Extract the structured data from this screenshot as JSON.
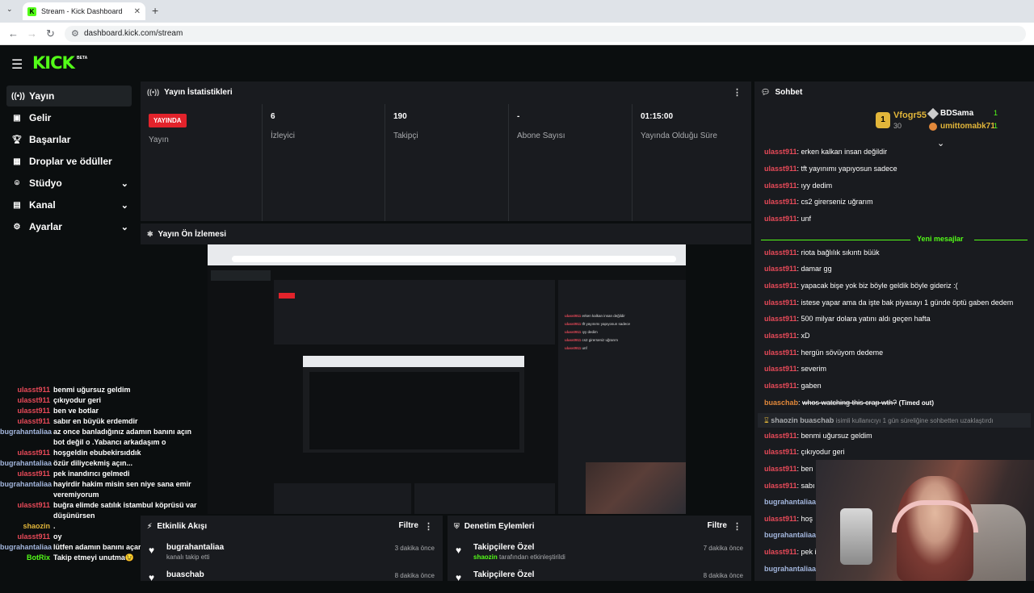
{
  "browser": {
    "tab_title": "Stream - Kick Dashboard",
    "url": "dashboard.kick.com/stream",
    "new_tab": "+",
    "close": "✕"
  },
  "brand": {
    "logo": "KICK",
    "beta": "BETA"
  },
  "sidebar": {
    "items": [
      {
        "label": "Yayın",
        "icon": "broadcast-icon"
      },
      {
        "label": "Gelir",
        "icon": "wallet-icon"
      },
      {
        "label": "Başarılar",
        "icon": "trophy-icon"
      },
      {
        "label": "Droplar ve ödüller",
        "icon": "gift-icon"
      },
      {
        "label": "Stüdyo",
        "icon": "studio-icon"
      },
      {
        "label": "Kanal",
        "icon": "channel-icon"
      },
      {
        "label": "Ayarlar",
        "icon": "gear-icon"
      }
    ]
  },
  "stats": {
    "title": "Yayın İstatistikleri",
    "live_badge": "YAYINDA",
    "live_label": "Yayın",
    "viewers": "6",
    "viewers_label": "İzleyici",
    "followers": "190",
    "followers_label": "Takipçi",
    "subs": "-",
    "subs_label": "Abone Sayısı",
    "uptime": "01:15:00",
    "uptime_label": "Yayında Olduğu Süre"
  },
  "preview": {
    "title": "Yayın Ön İzlemesi"
  },
  "overlay_chat": [
    {
      "user": "ulasst911",
      "msg": "benmi uğursuz geldim",
      "c": ""
    },
    {
      "user": "ulasst911",
      "msg": "çıkıyodur geri",
      "c": ""
    },
    {
      "user": "ulasst911",
      "msg": "ben ve botlar",
      "c": ""
    },
    {
      "user": "ulasst911",
      "msg": "sabır en büyük erdemdir",
      "c": ""
    },
    {
      "user": "bugrahantaliaa",
      "msg": "az once banladığınız adamın banını açın bot değil o .Yabancı arkadaşım o",
      "c": "blue"
    },
    {
      "user": "ulasst911",
      "msg": "hoşgeldin ebubekirsıddık",
      "c": ""
    },
    {
      "user": "bugrahantaliaa",
      "msg": "özür diliycekmiş açın...",
      "c": "blue"
    },
    {
      "user": "ulasst911",
      "msg": "pek inandırıcı gelmedi",
      "c": ""
    },
    {
      "user": "bugrahantaliaa",
      "msg": "hayirdir hakim misin sen niye sana emir veremiyorum",
      "c": "blue"
    },
    {
      "user": "ulasst911",
      "msg": "buğra elimde satılık istambul köprüsü var düşünürsen",
      "c": ""
    },
    {
      "user": "shaozin",
      "msg": ".",
      "c": "yellow"
    },
    {
      "user": "ulasst911",
      "msg": "oy",
      "c": ""
    },
    {
      "user": "bugrahantaliaa",
      "msg": "lütfen adamın banını açar mısın ?",
      "c": "blue"
    },
    {
      "user": "BotRix",
      "msg": "Takip etmeyi unutma😉",
      "c": "green"
    }
  ],
  "activity": {
    "title": "Etkinlik Akışı",
    "filter": "Filtre",
    "items": [
      {
        "title": "bugrahantaliaa",
        "sub": "kanalı takip etti",
        "time": "3 dakika önce"
      },
      {
        "title": "buaschab",
        "sub": "",
        "time": "8 dakika önce"
      }
    ]
  },
  "moderation": {
    "title": "Denetim Eylemleri",
    "filter": "Filtre",
    "items": [
      {
        "title": "Takipçilere Özel",
        "user": "shaozin",
        "sub": "tarafından etkinleştirildi",
        "time": "7 dakika önce"
      },
      {
        "title": "Takipçilere Özel",
        "user": "",
        "sub": "",
        "time": "8 dakika önce"
      }
    ]
  },
  "chat": {
    "title": "Sohbet",
    "gifters": [
      {
        "name": "Vfogr55",
        "count": "30"
      },
      {
        "name": "BDSama",
        "count": "1"
      },
      {
        "name": "umittomabk71",
        "count": "1"
      }
    ],
    "new_messages": "Yeni mesajlar",
    "lines": [
      {
        "user": "ulasst911",
        "msg": "erken kalkan insan değildir",
        "c": ""
      },
      {
        "user": "ulasst911",
        "msg": "tft yayınımı yapıyosun sadece",
        "c": ""
      },
      {
        "user": "ulasst911",
        "msg": "ıyy dedim",
        "c": ""
      },
      {
        "user": "ulasst911",
        "msg": "cs2 girerseniz uğrarım",
        "c": ""
      },
      {
        "user": "ulasst911",
        "msg": "unf",
        "c": ""
      },
      {
        "user": "ulasst911",
        "msg": "riota bağlılık sıkıntı büük",
        "c": ""
      },
      {
        "user": "ulasst911",
        "msg": "damar gg",
        "c": ""
      },
      {
        "user": "ulasst911",
        "msg": "yapacak bişe yok biz böyle geldik böyle gideriz :(",
        "c": ""
      },
      {
        "user": "ulasst911",
        "msg": "istese yapar ama da işte bak piyasayı 1 günde öptü gaben dedem",
        "c": ""
      },
      {
        "user": "ulasst911",
        "msg": "500 milyar dolara yatını aldı geçen hafta",
        "c": ""
      },
      {
        "user": "ulasst911",
        "msg": "xD",
        "c": ""
      },
      {
        "user": "ulasst911",
        "msg": "hergün sövüyom dedeme",
        "c": ""
      },
      {
        "user": "ulasst911",
        "msg": "severim",
        "c": ""
      },
      {
        "user": "ulasst911",
        "msg": "gaben",
        "c": ""
      },
      {
        "user": "buaschab",
        "msg": "whos watching this crap wth?",
        "c": "orange"
      },
      {
        "user": "shaozin",
        "msg": "buaschab",
        "c": "mod"
      },
      {
        "user": "ulasst911",
        "msg": "benmi uğursuz geldim",
        "c": ""
      },
      {
        "user": "ulasst911",
        "msg": "çıkıyodur geri",
        "c": ""
      },
      {
        "user": "ulasst911",
        "msg": "ben",
        "c": ""
      },
      {
        "user": "ulasst911",
        "msg": "sabı",
        "c": ""
      },
      {
        "user": "bugrahantaliaa",
        "msg": "",
        "c": "blue"
      },
      {
        "user": "ulasst911",
        "msg": "hoş",
        "c": ""
      },
      {
        "user": "bugrahantaliaa",
        "msg": "",
        "c": "blue"
      },
      {
        "user": "ulasst911",
        "msg": "pek i",
        "c": ""
      },
      {
        "user": "bugrahantaliaa",
        "msg": "",
        "c": "blue"
      }
    ],
    "timed_out": "(Timed out)",
    "mod_text": "isimli kullanıcıyı 1 gün süreliğine sohbetten uzaklaştırdı"
  }
}
